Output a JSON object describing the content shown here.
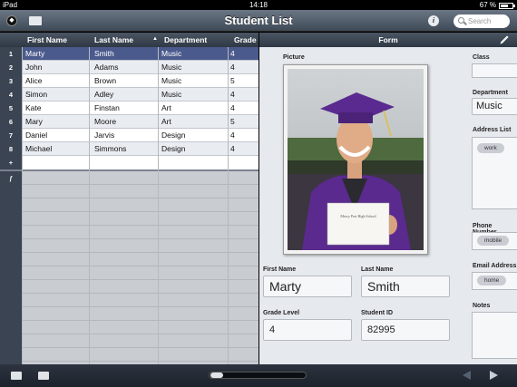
{
  "status": {
    "device": "iPad",
    "time": "14:18",
    "battery": "67 %",
    "battery_level": 0.67
  },
  "title": "Student List",
  "search": {
    "placeholder": "Search"
  },
  "table": {
    "columns": [
      "First Name",
      "Last Name",
      "Department",
      "Grade"
    ],
    "rows": [
      {
        "num": "1",
        "first": "Marty",
        "last": "Smith",
        "dept": "Music",
        "grade": "4"
      },
      {
        "num": "2",
        "first": "John",
        "last": "Adams",
        "dept": "Music",
        "grade": "4"
      },
      {
        "num": "3",
        "first": "Alice",
        "last": "Brown",
        "dept": "Music",
        "grade": "5"
      },
      {
        "num": "4",
        "first": "Simon",
        "last": "Adley",
        "dept": "Music",
        "grade": "4"
      },
      {
        "num": "5",
        "first": "Kate",
        "last": "Finstan",
        "dept": "Art",
        "grade": "4"
      },
      {
        "num": "6",
        "first": "Mary",
        "last": "Moore",
        "dept": "Art",
        "grade": "5"
      },
      {
        "num": "7",
        "first": "Daniel",
        "last": "Jarvis",
        "dept": "Design",
        "grade": "4"
      },
      {
        "num": "8",
        "first": "Michael",
        "last": "Simmons",
        "dept": "Design",
        "grade": "4"
      }
    ],
    "add_marker": "+",
    "formula_marker": "f"
  },
  "form": {
    "header": "Form",
    "picture_label": "Picture",
    "photo_card_text": "Mercy Port High School",
    "first_name_label": "First Name",
    "first_name": "Marty",
    "last_name_label": "Last Name",
    "last_name": "Smith",
    "grade_label": "Grade Level",
    "grade": "4",
    "student_id_label": "Student ID",
    "student_id": "82995",
    "class_label": "Class",
    "department_label": "Department",
    "department": "Music",
    "address_label": "Address List",
    "address_pill": "work",
    "phone_label": "Phone Number",
    "phone_pill": "mobile",
    "email_label": "Email Address",
    "email_pill": "home",
    "notes_label": "Notes"
  },
  "colors": {
    "selected_row": "#4b5a8c",
    "header_bg": "#2f3844",
    "gown": "#5a2a8e"
  }
}
